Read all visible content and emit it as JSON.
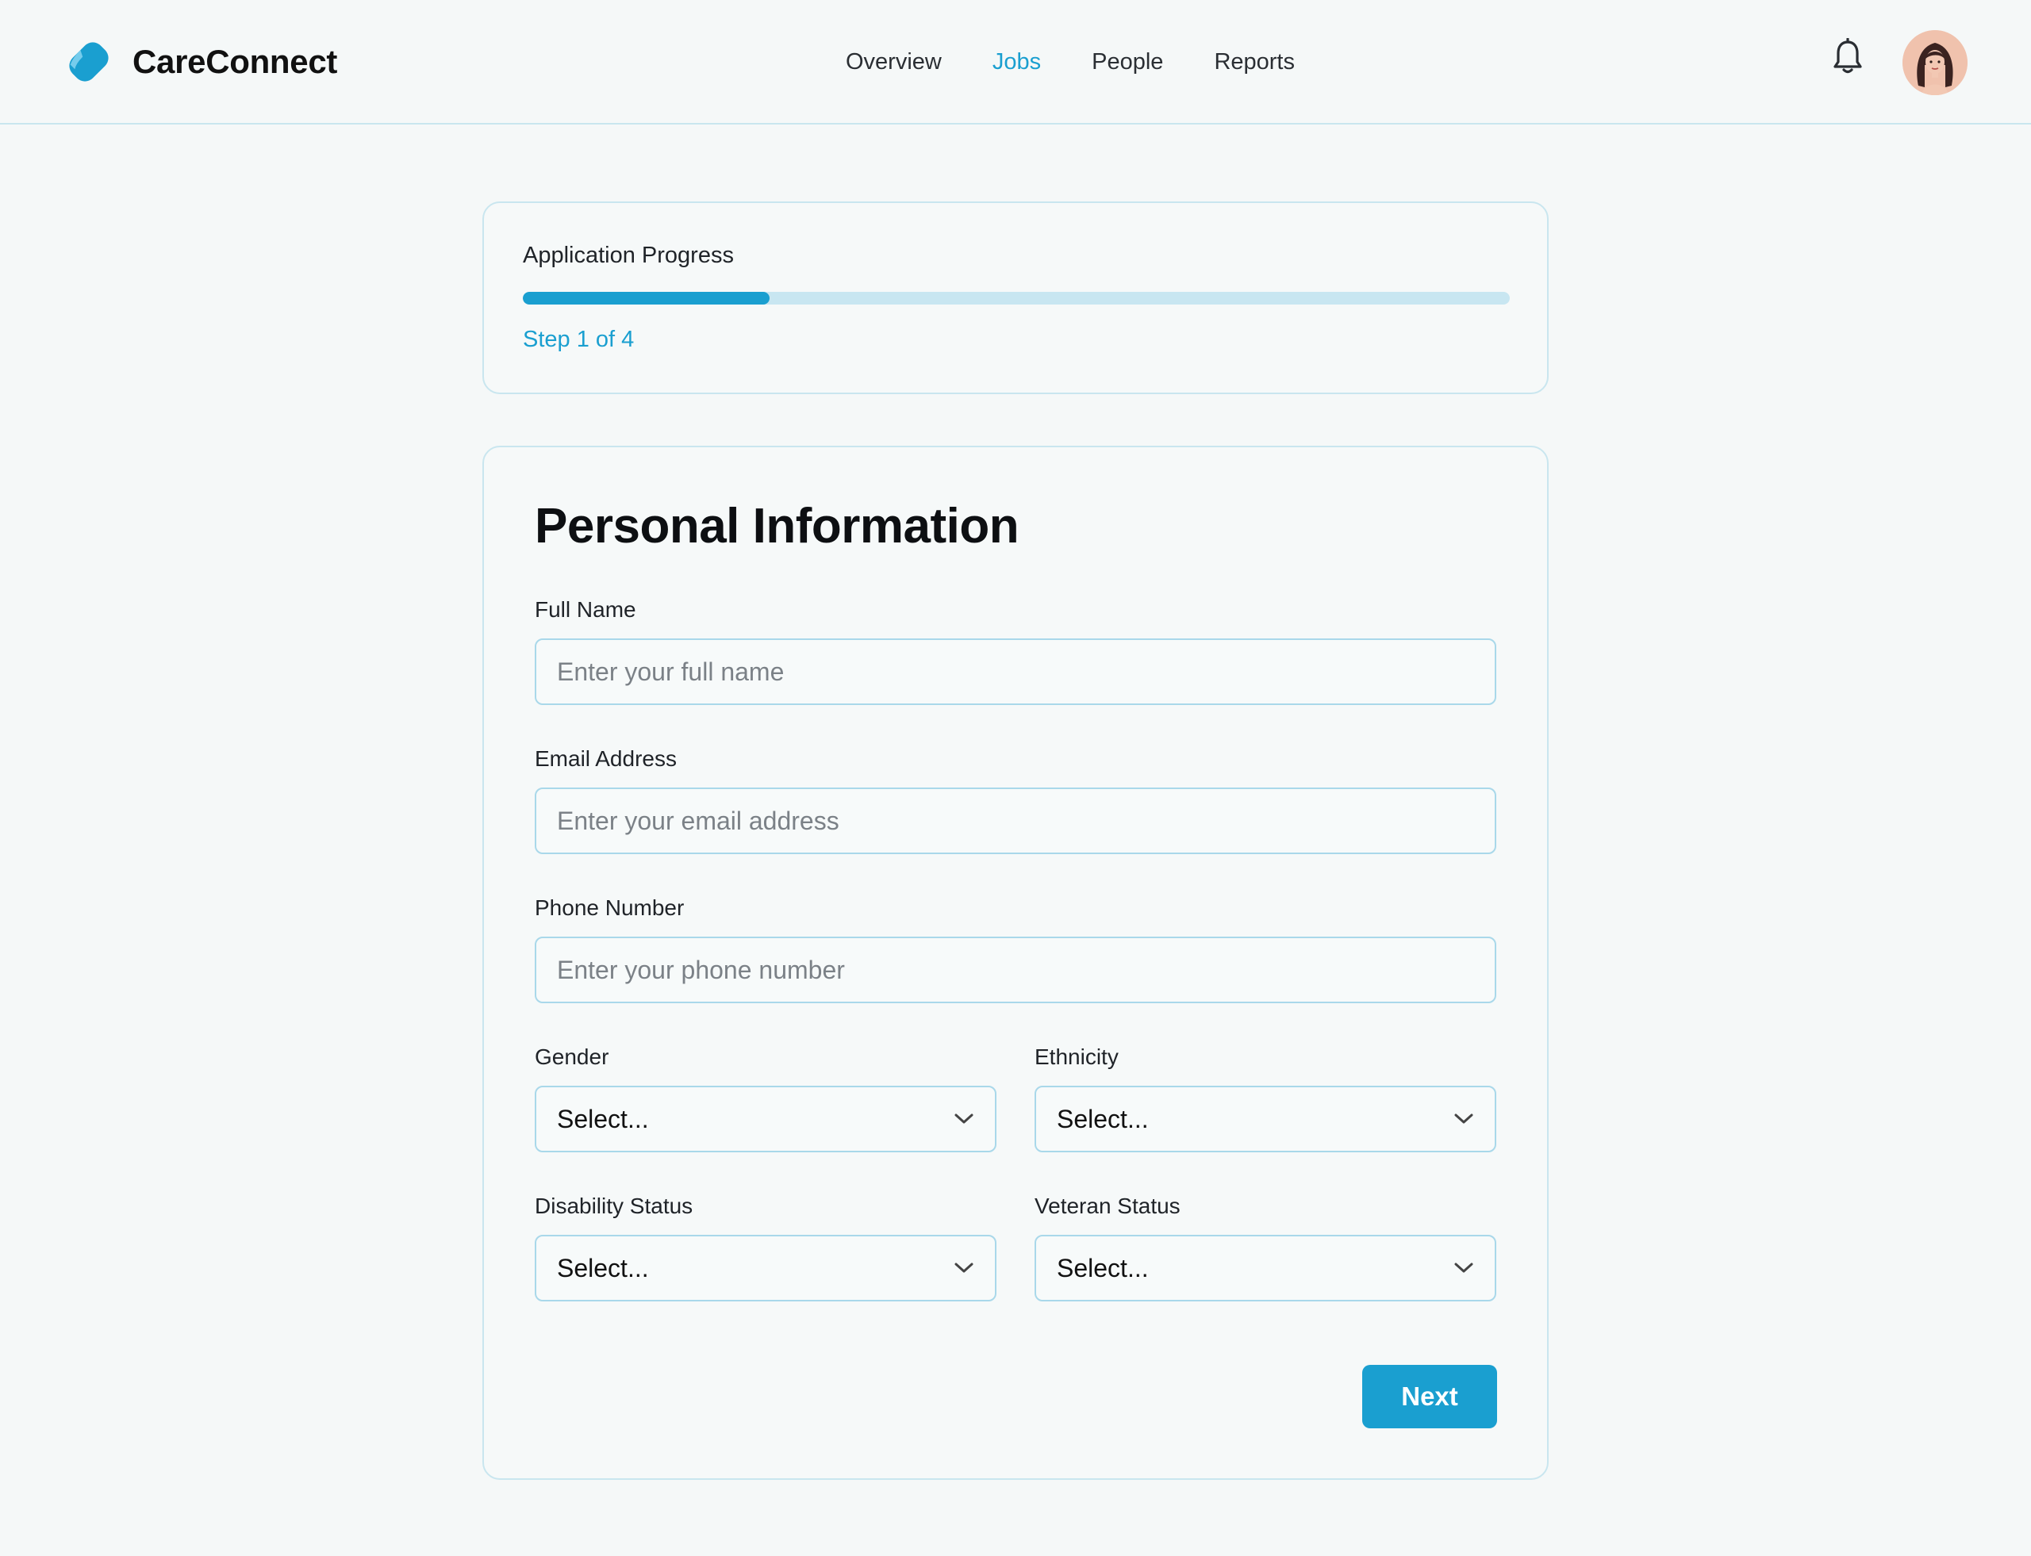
{
  "app": {
    "name": "CareConnect"
  },
  "nav": {
    "items": [
      {
        "label": "Overview",
        "active": false
      },
      {
        "label": "Jobs",
        "active": true
      },
      {
        "label": "People",
        "active": false
      },
      {
        "label": "Reports",
        "active": false
      }
    ]
  },
  "header": {
    "bell_icon": "bell-icon",
    "avatar": "user-avatar"
  },
  "progress": {
    "title": "Application Progress",
    "step_text": "Step 1 of 4",
    "percent": 25
  },
  "form": {
    "title": "Personal Information",
    "full_name": {
      "label": "Full Name",
      "placeholder": "Enter your full name",
      "value": ""
    },
    "email": {
      "label": "Email Address",
      "placeholder": "Enter your email address",
      "value": ""
    },
    "phone": {
      "label": "Phone Number",
      "placeholder": "Enter your phone number",
      "value": ""
    },
    "gender": {
      "label": "Gender",
      "value": "Select..."
    },
    "ethnicity": {
      "label": "Ethnicity",
      "value": "Select..."
    },
    "disability": {
      "label": "Disability Status",
      "value": "Select..."
    },
    "veteran": {
      "label": "Veteran Status",
      "value": "Select..."
    },
    "next_label": "Next"
  },
  "colors": {
    "accent": "#1a9fd0",
    "border": "#a9d8ea",
    "track": "#c8e6f1",
    "background": "#f5f8f8"
  }
}
